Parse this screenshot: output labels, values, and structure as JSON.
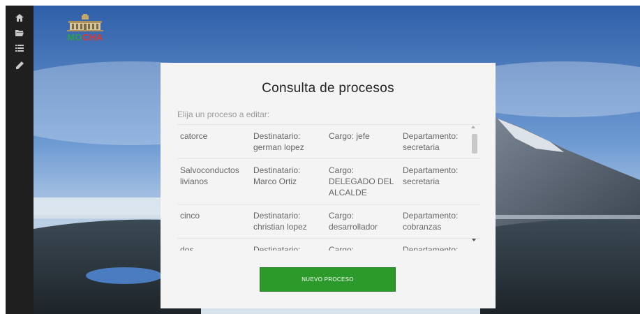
{
  "logo": {
    "part1": "MO",
    "part2": "C",
    "part3": "HA"
  },
  "sidebar": {
    "items": [
      {
        "icon": "home-icon"
      },
      {
        "icon": "folder-icon"
      },
      {
        "icon": "list-icon"
      },
      {
        "icon": "pencil-icon"
      }
    ]
  },
  "panel": {
    "title": "Consulta de procesos",
    "subtitle": "Elija un proceso a editar:",
    "rows": [
      {
        "name": "catorce",
        "destinatario": "Destinatario: german lopez",
        "cargo": "Cargo: jefe",
        "departamento": "Departamento: secretaria"
      },
      {
        "name": "Salvoconductos livianos",
        "destinatario": "Destinatario: Marco Ortiz",
        "cargo": "Cargo: DELEGADO DEL ALCALDE",
        "departamento": "Departamento: secretaria"
      },
      {
        "name": "cinco",
        "destinatario": "Destinatario: christian lopez",
        "cargo": "Cargo: desarrollador",
        "departamento": "Departamento: cobranzas"
      },
      {
        "name": "dos",
        "destinatario": "Destinatario:",
        "cargo": "Cargo:",
        "departamento": "Departamento:"
      }
    ],
    "button_label": "NUEVO PROCESO"
  },
  "colors": {
    "accent": "#2b9a2b",
    "sidebar": "#1f1f1f"
  }
}
